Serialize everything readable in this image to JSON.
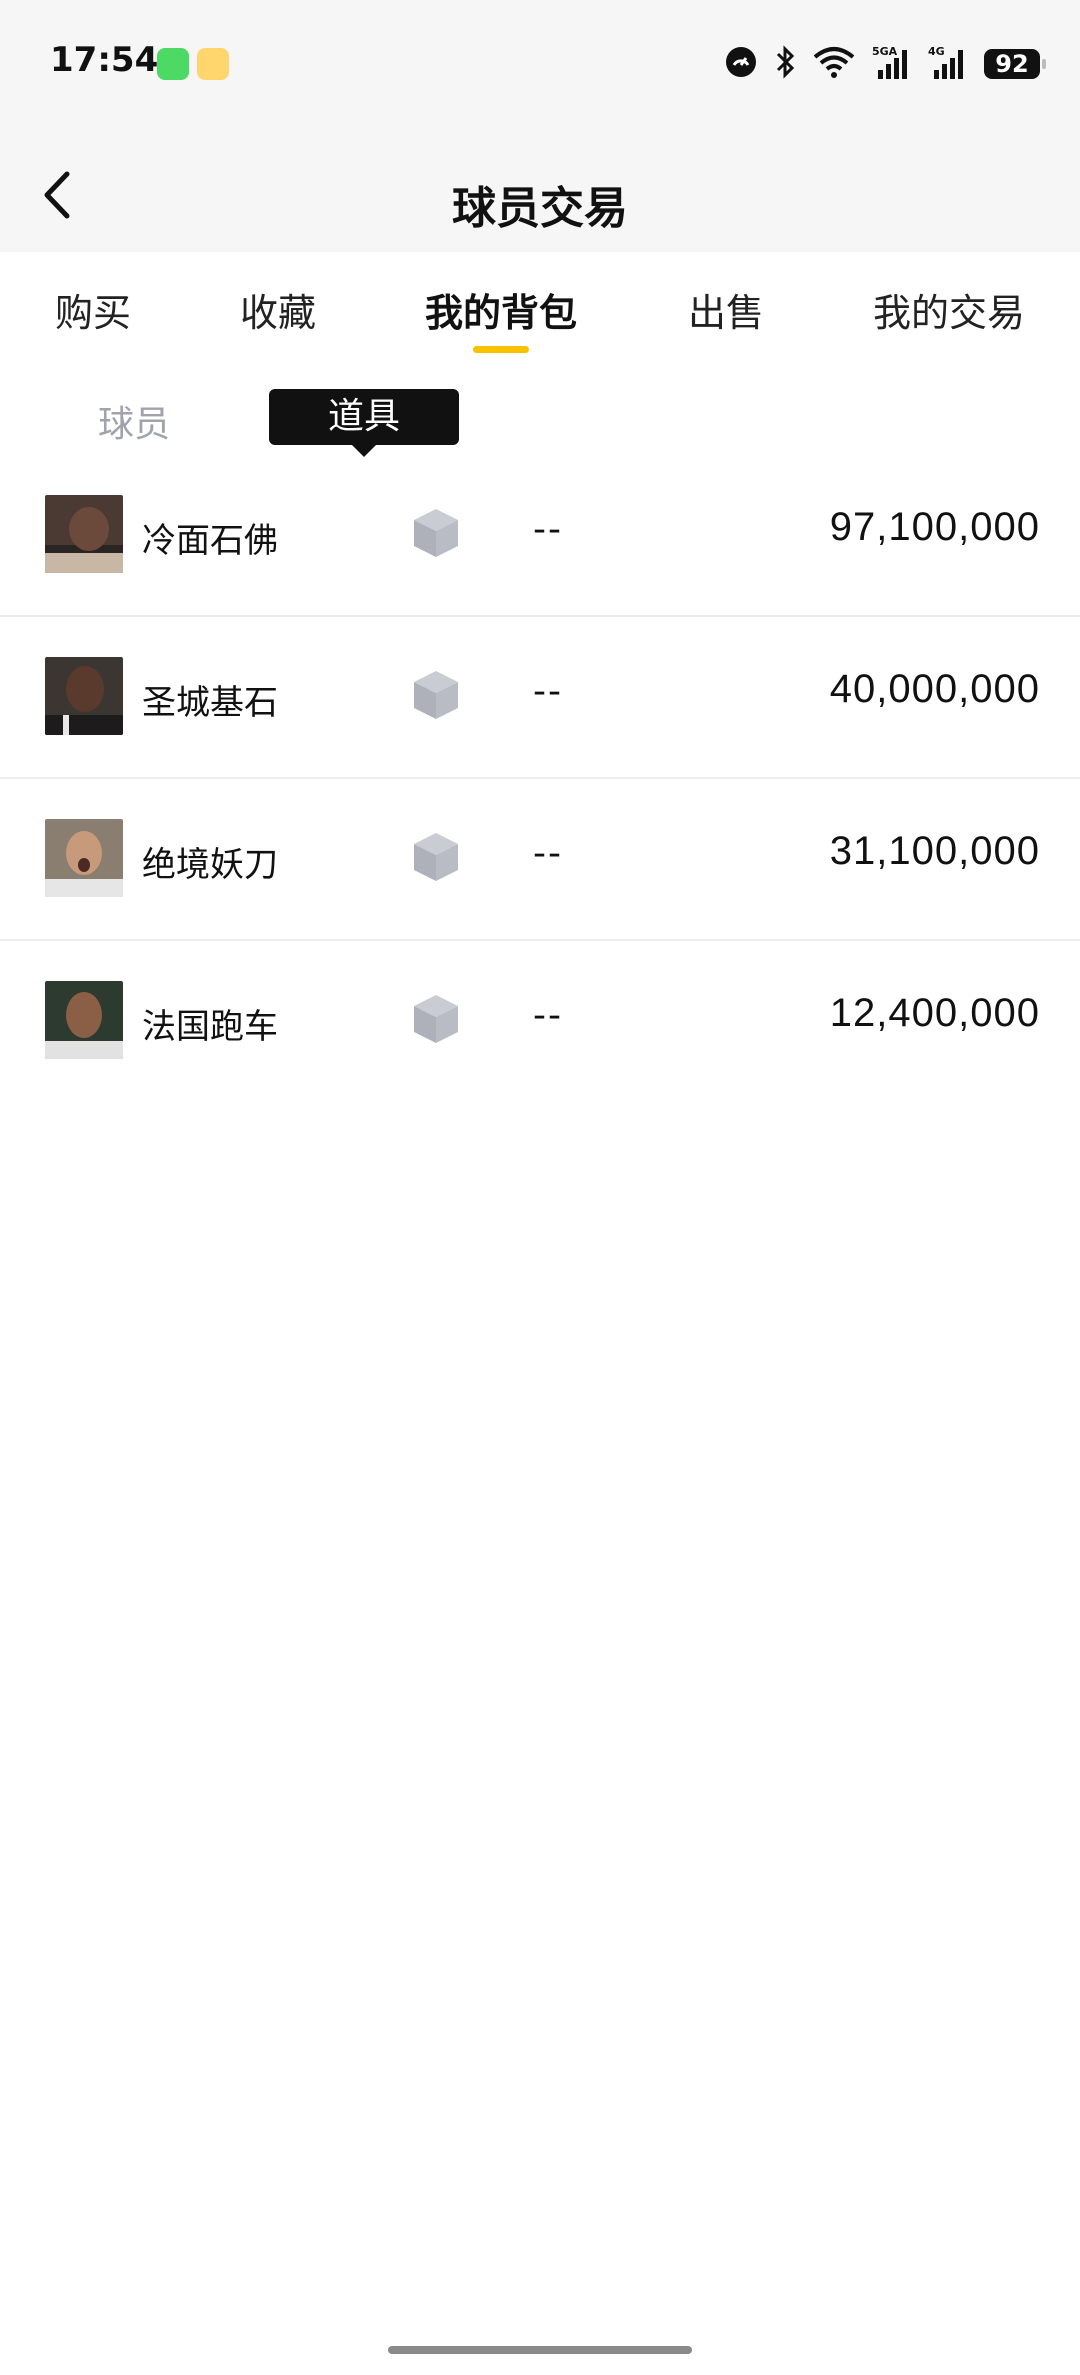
{
  "status_bar": {
    "time": "17:54",
    "network_5g": "5GA",
    "network_4g": "4G",
    "battery": "92",
    "icons": [
      "messages-icon",
      "weibo-icon",
      "gauge-icon",
      "bluetooth-icon",
      "wifi-icon",
      "signal-icon",
      "signal-icon"
    ]
  },
  "header": {
    "title": "球员交易",
    "back_icon": "chevron-left-icon"
  },
  "tabs": [
    {
      "label": "购买"
    },
    {
      "label": "收藏"
    },
    {
      "label": "我的背包",
      "active": true
    },
    {
      "label": "出售"
    },
    {
      "label": "我的交易"
    }
  ],
  "sub_tabs": {
    "player": "球员",
    "item": "道具"
  },
  "items": [
    {
      "name": "冷面石佛",
      "value": "--",
      "price": "97,100,000"
    },
    {
      "name": "圣城基石",
      "value": "--",
      "price": "40,000,000"
    },
    {
      "name": "绝境妖刀",
      "value": "--",
      "price": "31,100,000"
    },
    {
      "name": "法国跑车",
      "value": "--",
      "price": "12,400,000"
    }
  ],
  "colors": {
    "accent": "#f8c200",
    "header_bg": "#f6f6f6",
    "muted_text": "#a0a3ab",
    "cube": "#b3b6be"
  }
}
